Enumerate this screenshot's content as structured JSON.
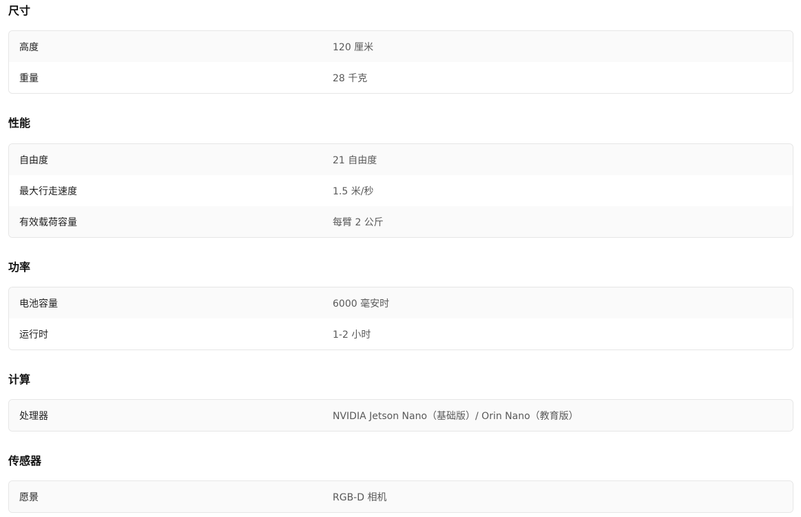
{
  "sections": [
    {
      "title": "尺寸",
      "rows": [
        {
          "label": "高度",
          "value": "120 厘米"
        },
        {
          "label": "重量",
          "value": "28 千克"
        }
      ]
    },
    {
      "title": "性能",
      "rows": [
        {
          "label": "自由度",
          "value": "21 自由度"
        },
        {
          "label": "最大行走速度",
          "value": "1.5 米/秒"
        },
        {
          "label": "有效载荷容量",
          "value": "每臂 2 公斤"
        }
      ]
    },
    {
      "title": "功率",
      "rows": [
        {
          "label": "电池容量",
          "value": "6000 毫安时"
        },
        {
          "label": "运行时",
          "value": "1-2 小时"
        }
      ]
    },
    {
      "title": "计算",
      "rows": [
        {
          "label": "处理器",
          "value": "NVIDIA Jetson Nano（基础版）/ Orin Nano（教育版）"
        }
      ]
    },
    {
      "title": "传感器",
      "rows": [
        {
          "label": "愿景",
          "value": "RGB-D 相机"
        }
      ]
    }
  ]
}
